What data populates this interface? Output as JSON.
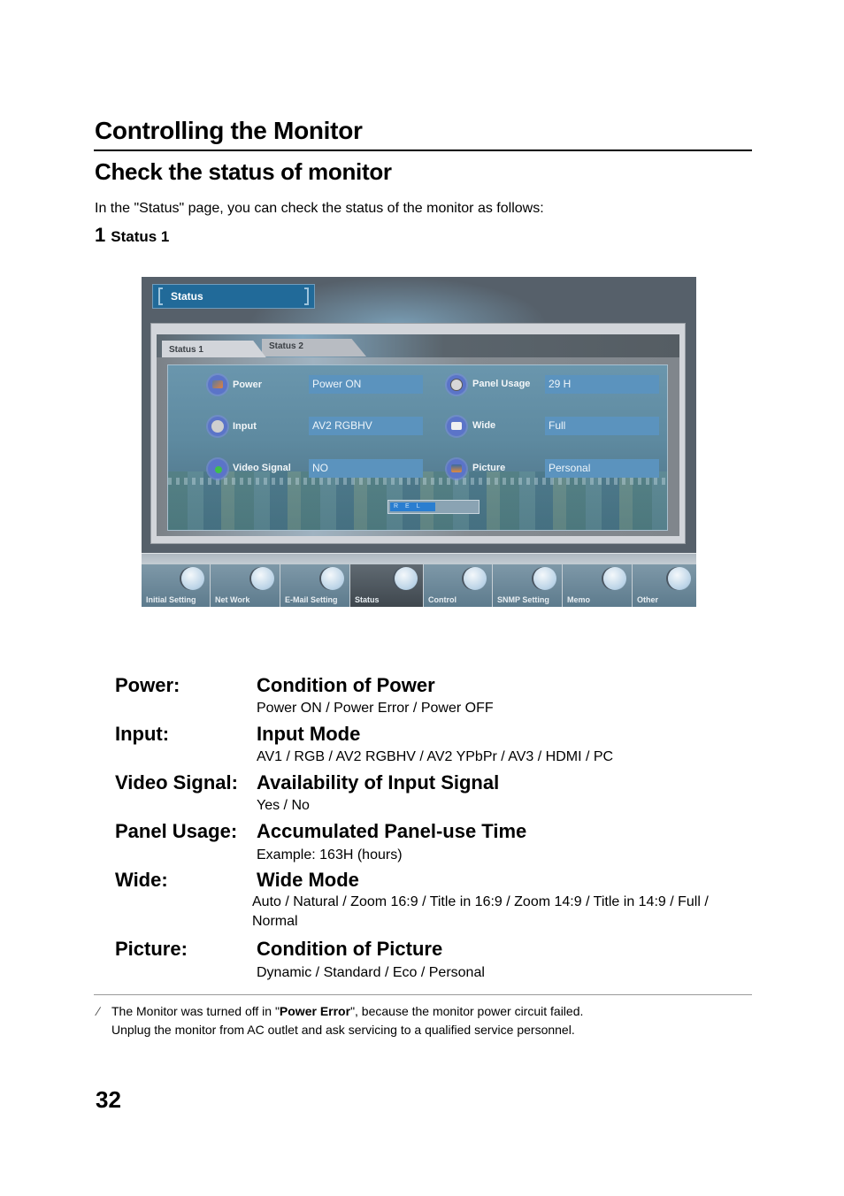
{
  "header": {
    "title": "Controlling the Monitor",
    "subtitle": "Check the status of monitor",
    "intro": "In the \"Status\" page, you can check the status of the monitor as follows:",
    "step_number": "1",
    "step_label": "Status 1"
  },
  "screenshot": {
    "page_title": "Status",
    "tabs": [
      {
        "label": "Status 1",
        "active": true
      },
      {
        "label": "Status 2",
        "active": false
      }
    ],
    "left_rows": [
      {
        "icon": "power-icon",
        "label": "Power",
        "value": "Power ON"
      },
      {
        "icon": "input-icon",
        "label": "Input",
        "value": "AV2 RGBHV"
      },
      {
        "icon": "video-signal-icon",
        "label": "Video Signal",
        "value": "NO"
      }
    ],
    "right_rows": [
      {
        "icon": "clock-icon",
        "label": "Panel Usage",
        "value": "29 H"
      },
      {
        "icon": "wide-icon",
        "label": "Wide",
        "value": "Full"
      },
      {
        "icon": "picture-icon",
        "label": "Picture",
        "value": "Personal"
      }
    ],
    "refresh_label": "REL",
    "nav": [
      {
        "label": "Initial Setting",
        "icon": "pen-icon"
      },
      {
        "label": "Net Work",
        "icon": "network-icon"
      },
      {
        "label": "E-Mail Setting",
        "icon": "mail-icon"
      },
      {
        "label": "Status",
        "icon": "status-icon",
        "active": true
      },
      {
        "label": "Control",
        "icon": "control-icon"
      },
      {
        "label": "SNMP Setting",
        "icon": "snmp-icon"
      },
      {
        "label": "Memo",
        "icon": "memo-icon"
      },
      {
        "label": "Other",
        "icon": "other-icon"
      }
    ]
  },
  "definitions": [
    {
      "term": "Power:",
      "title": "Condition of Power",
      "desc": "Power ON / Power Error / Power OFF"
    },
    {
      "term": "Input:",
      "title": "Input Mode",
      "desc": "AV1 / RGB / AV2 RGBHV / AV2 YPbPr / AV3 / HDMI / PC"
    },
    {
      "term": "Video Signal:",
      "title": "Availability of Input Signal",
      "desc": "Yes / No"
    },
    {
      "term": "Panel Usage:",
      "title": "Accumulated Panel-use Time",
      "desc": "Example: 163H (hours)"
    },
    {
      "term": "Wide:",
      "title": "Wide Mode",
      "desc": "Auto / Natural / Zoom 16:9 / Title in 16:9 / Zoom 14:9 / Title in 14:9 / Full / Normal"
    },
    {
      "term": "Picture:",
      "title": "Condition of Picture",
      "desc": "Dynamic / Standard / Eco / Personal"
    }
  ],
  "note": {
    "pre": "The Monitor was turned off in \"",
    "bold": "Power Error",
    "post": "\", because the monitor power circuit failed.",
    "line2": "Unplug the monitor from AC outlet and ask servicing to a qualified service personnel."
  },
  "page_number": "32"
}
